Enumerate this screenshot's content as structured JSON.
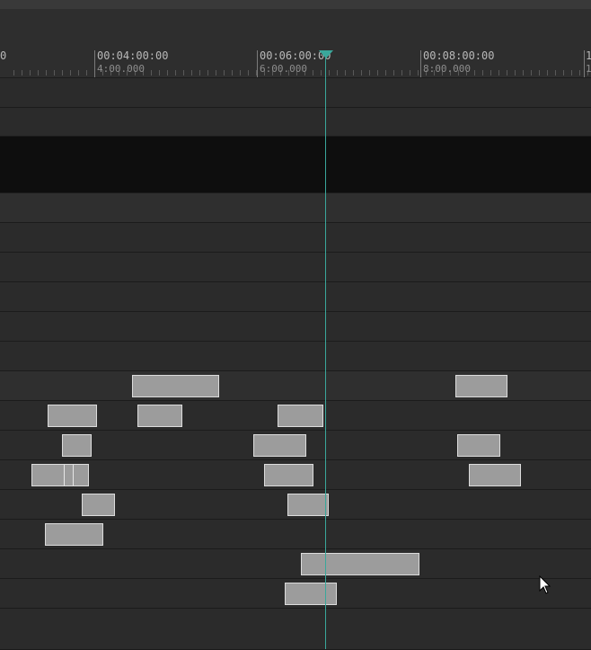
{
  "ruler": {
    "labels": [
      {
        "primary": "0",
        "secondary": ""
      },
      {
        "primary": "00:04:00:00",
        "secondary": "4:00.000"
      },
      {
        "primary": "00:06:00:00",
        "secondary": "6:00.000"
      },
      {
        "primary": "00:08:00:00",
        "secondary": "8:00.000"
      },
      {
        "primary": "1",
        "secondary": "1"
      }
    ]
  },
  "playhead": {
    "timecode": "00:06:00:00"
  },
  "colors": {
    "background": "#2a2a2a",
    "ruler": "#2e2e2e",
    "clip_fill": "#9c9c9c",
    "clip_border": "#dcdcdc",
    "playhead": "#3aa79b",
    "empty_track": "#0e0e0e"
  },
  "icons": {
    "pointer": "mouse-pointer-icon",
    "playhead": "playhead-marker-icon"
  }
}
